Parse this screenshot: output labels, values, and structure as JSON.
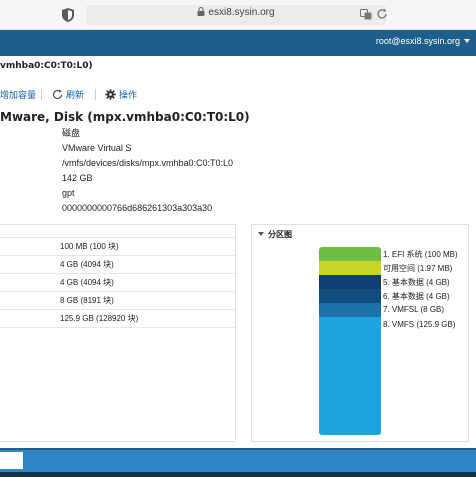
{
  "browser": {
    "url": "esxi8.sysin.org"
  },
  "header": {
    "user": "root@esxi8.sysin.org"
  },
  "breadcrumb": "vmhba0:C0:T0:L0)",
  "toolbar": {
    "add_capacity": "增加容量",
    "refresh": "刷新",
    "actions": "操作"
  },
  "disk": {
    "title": "Mware, Disk (mpx.vmhba0:C0:T0:L0)",
    "properties": [
      "磁盘",
      "VMware Virtual S",
      "/vmfs/devices/disks/mpx.vmhba0:C0:T0:L0",
      "142 GB",
      "gpt",
      "0000000000766d686261303a303a30"
    ]
  },
  "partitions_table": {
    "rows": [
      "100 MB (100 块)",
      "4 GB (4094 块)",
      "4 GB (4094 块)",
      "8 GB (8191 块)",
      "125.9 GB (128920 块)"
    ]
  },
  "partition_map": {
    "title": "分区图",
    "segments": [
      {
        "label": "1. EFI 系统  (100 MB)",
        "color": "#6ebd44",
        "gb": 0.1
      },
      {
        "label": "可用空间  (1.97 MB)",
        "color": "#c8d629",
        "gb": 0.002
      },
      {
        "label": "5. 基本数据  (4 GB)",
        "color": "#0f3d6f",
        "gb": 4
      },
      {
        "label": "6. 基本数据  (4 GB)",
        "color": "#114e80",
        "gb": 4
      },
      {
        "label": "7. VMFSL  (8 GB)",
        "color": "#1b72a8",
        "gb": 8
      },
      {
        "label": "8. VMFS  (125.9 GB)",
        "color": "#1ea4df",
        "gb": 125.9
      }
    ]
  }
}
